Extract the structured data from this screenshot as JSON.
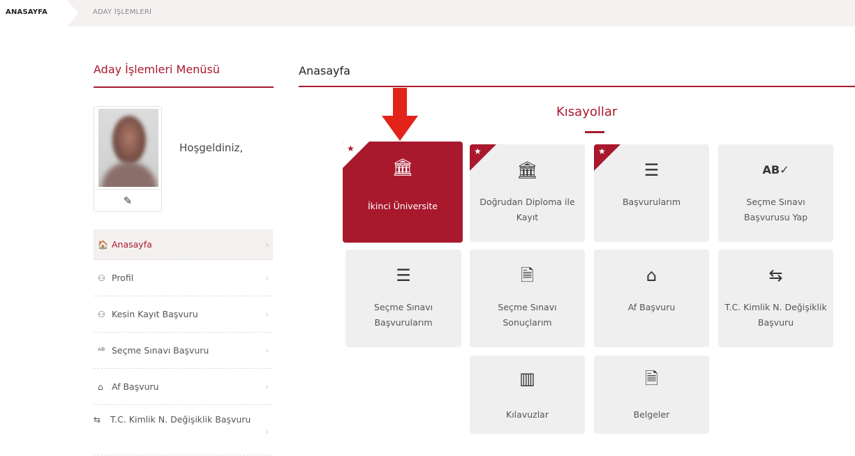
{
  "breadcrumb": {
    "home": "ANASAYFA",
    "current": "ADAY İŞLEMLERİ"
  },
  "sidebar": {
    "title": "Aday İşlemleri Menüsü",
    "welcome": "Hoşgeldiniz,",
    "edit_icon": "pencil-icon",
    "items": [
      {
        "label": "Anasayfa",
        "icon": "🏠",
        "chevron": "›"
      },
      {
        "label": "Profil",
        "icon": "⚇",
        "chevron": "›"
      },
      {
        "label": "Kesin Kayıt Başvuru",
        "icon": "⚇",
        "chevron": "›"
      },
      {
        "label": "Seçme Sınavı Başvuru",
        "icon": "ᴬᴮ",
        "chevron": "›"
      },
      {
        "label": "Af Başvuru",
        "icon": "⌂",
        "chevron": "›"
      },
      {
        "label": "T.C. Kimlik N. Değişiklik Başvuru",
        "icon": "⇆",
        "chevron": "›"
      }
    ]
  },
  "main": {
    "title": "Anasayfa",
    "shortcuts_title": "Kısayollar",
    "tiles": [
      {
        "label": "İkinci Üniversite",
        "icon": "🏛",
        "starred": true,
        "highlighted": true
      },
      {
        "label": "Doğrudan Diploma ile Kayıt",
        "icon": "🏛",
        "starred": true,
        "highlighted": false
      },
      {
        "label": "Başvurularım",
        "icon": "☰",
        "starred": true,
        "highlighted": false
      },
      {
        "label": "Seçme Sınavı Başvurusu Yap",
        "icon": "AB✓",
        "starred": false,
        "highlighted": false
      },
      {
        "label": "Seçme Sınavı Başvurularım",
        "icon": "☰",
        "starred": false,
        "highlighted": false
      },
      {
        "label": "Seçme Sınavı Sonuçlarım",
        "icon": "🗎",
        "starred": false,
        "highlighted": false
      },
      {
        "label": "Af Başvuru",
        "icon": "⌂",
        "starred": false,
        "highlighted": false
      },
      {
        "label": "T.C. Kimlik N. Değişiklik Başvuru",
        "icon": "⇆",
        "starred": false,
        "highlighted": false
      },
      {
        "label": "Kılavuzlar",
        "icon": "▥",
        "starred": false,
        "highlighted": false
      },
      {
        "label": "Belgeler",
        "icon": "🗎",
        "starred": false,
        "highlighted": false
      }
    ]
  },
  "colors": {
    "accent": "#a8192e",
    "tile_bg": "#efefef",
    "breadcrumb_bg": "#f5f1f1"
  }
}
